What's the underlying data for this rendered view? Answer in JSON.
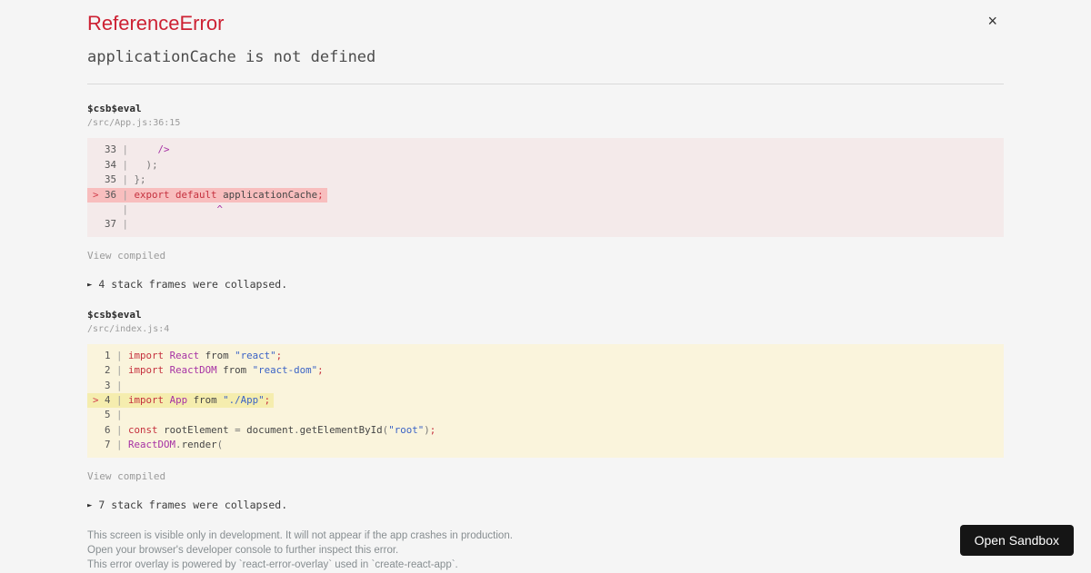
{
  "overlay": {
    "title": "ReferenceError",
    "message": "applicationCache is not defined",
    "close_glyph": "×"
  },
  "open_sandbox": "Open Sandbox",
  "frames": [
    {
      "function": "$csb$eval",
      "location": "/src/App.js:36:15",
      "view_compiled": "View compiled",
      "collapsed": {
        "icon": "►",
        "text": "4 stack frames were collapsed."
      },
      "code": {
        "variant": "error",
        "lines": [
          {
            "hl": false,
            "tokens": [
              [
                "  33 ",
                "n"
              ],
              [
                "| ",
                "b"
              ],
              [
                "    ",
                "x"
              ],
              [
                "/>",
                "t"
              ]
            ]
          },
          {
            "hl": false,
            "tokens": [
              [
                "  34 ",
                "n"
              ],
              [
                "| ",
                "b"
              ],
              [
                "  ",
                "x"
              ],
              [
                ")",
                "p"
              ],
              [
                ";",
                "p"
              ]
            ]
          },
          {
            "hl": false,
            "tokens": [
              [
                "  35 ",
                "n"
              ],
              [
                "| ",
                "b"
              ],
              [
                "}",
                "p"
              ],
              [
                ";",
                "p"
              ]
            ]
          },
          {
            "hl": true,
            "tokens": [
              [
                "> ",
                "m"
              ],
              [
                "36 ",
                "n"
              ],
              [
                "| ",
                "b"
              ],
              [
                "export default",
                "k"
              ],
              [
                " ",
                "x"
              ],
              [
                "applicationCache",
                "i"
              ],
              [
                ";",
                "k"
              ]
            ]
          },
          {
            "hl": false,
            "tokens": [
              [
                "     ",
                "x"
              ],
              [
                "| ",
                "b"
              ],
              [
                "              ",
                "x"
              ],
              [
                "^",
                "t"
              ]
            ]
          },
          {
            "hl": false,
            "tokens": [
              [
                "  37 ",
                "n"
              ],
              [
                "| ",
                "b"
              ]
            ]
          }
        ]
      }
    },
    {
      "function": "$csb$eval",
      "location": "/src/index.js:4",
      "view_compiled": "View compiled",
      "collapsed": {
        "icon": "►",
        "text": "7 stack frames were collapsed."
      },
      "code": {
        "variant": "warning",
        "lines": [
          {
            "hl": false,
            "tokens": [
              [
                "  1 ",
                "n"
              ],
              [
                "| ",
                "b"
              ],
              [
                "import",
                "k"
              ],
              [
                " ",
                "x"
              ],
              [
                "React",
                "t"
              ],
              [
                " from ",
                "x"
              ],
              [
                "\"react\"",
                "s"
              ],
              [
                ";",
                "k"
              ]
            ]
          },
          {
            "hl": false,
            "tokens": [
              [
                "  2 ",
                "n"
              ],
              [
                "| ",
                "b"
              ],
              [
                "import",
                "k"
              ],
              [
                " ",
                "x"
              ],
              [
                "ReactDOM",
                "t"
              ],
              [
                " from ",
                "x"
              ],
              [
                "\"react-dom\"",
                "s"
              ],
              [
                ";",
                "k"
              ]
            ]
          },
          {
            "hl": false,
            "tokens": [
              [
                "  3 ",
                "n"
              ],
              [
                "| ",
                "b"
              ]
            ]
          },
          {
            "hl": true,
            "tokens": [
              [
                "> ",
                "m"
              ],
              [
                "4 ",
                "n"
              ],
              [
                "| ",
                "b"
              ],
              [
                "import",
                "k"
              ],
              [
                " ",
                "x"
              ],
              [
                "App",
                "t"
              ],
              [
                " from ",
                "x"
              ],
              [
                "\"./App\"",
                "s"
              ],
              [
                ";",
                "k"
              ]
            ]
          },
          {
            "hl": false,
            "tokens": [
              [
                "  5 ",
                "n"
              ],
              [
                "| ",
                "b"
              ]
            ]
          },
          {
            "hl": false,
            "tokens": [
              [
                "  6 ",
                "n"
              ],
              [
                "| ",
                "b"
              ],
              [
                "const",
                "k"
              ],
              [
                " ",
                "x"
              ],
              [
                "rootElement",
                "i"
              ],
              [
                " ",
                "x"
              ],
              [
                "=",
                "p"
              ],
              [
                " ",
                "x"
              ],
              [
                "document",
                "i"
              ],
              [
                ".",
                "p"
              ],
              [
                "getElementById",
                "i"
              ],
              [
                "(",
                "p"
              ],
              [
                "\"root\"",
                "s"
              ],
              [
                ")",
                "p"
              ],
              [
                ";",
                "k"
              ]
            ]
          },
          {
            "hl": false,
            "tokens": [
              [
                "  7 ",
                "n"
              ],
              [
                "| ",
                "b"
              ],
              [
                "ReactDOM",
                "t"
              ],
              [
                ".",
                "p"
              ],
              [
                "render",
                "i"
              ],
              [
                "(",
                "p"
              ]
            ]
          }
        ]
      }
    }
  ],
  "footer": {
    "lines": [
      "This screen is visible only in development. It will not appear if the app crashes in production.",
      "Open your browser's developer console to further inspect this error.",
      "This error overlay is powered by `react-error-overlay` used in `create-react-app`."
    ]
  },
  "colors": {
    "page-bg": "#f5f5f5",
    "title-red": "#cd2133",
    "error-block-bg": "#f4eaea",
    "error-line-highlight": "#f8bebe",
    "warning-block-bg": "#faf4dc",
    "warning-line-highlight": "#f5edae",
    "keyword": "#c5303e",
    "capitalized": "#a631a4",
    "string": "#3b63c6",
    "plain": "#454545",
    "punct": "#757575",
    "lineno": "#555555",
    "bar": "#9c9c9c",
    "marker": "#d2404e",
    "footer-gray": "#878e91",
    "button-bg": "#151515",
    "button-text": "#ffffff"
  }
}
